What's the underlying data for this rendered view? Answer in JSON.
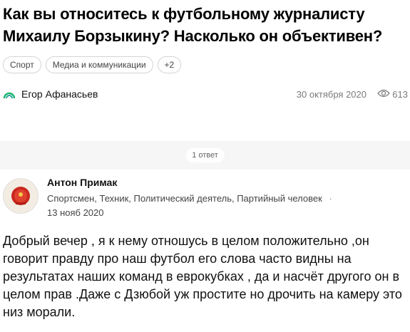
{
  "question": {
    "title": "Как вы относитесь к футбольному журналисту Михаилу Борзыкину? Насколько он объективен?",
    "tags": [
      "Спорт",
      "Медиа и коммуникации",
      "+2"
    ],
    "author": "Егор Афанасьев",
    "date": "30 октября 2020",
    "views": "613"
  },
  "answers_count": "1 ответ",
  "answer": {
    "author": "Антон Примак",
    "meta": "Спортсмен, Техник, Политический деятель, Партийный человек",
    "meta_sep": "·",
    "date": "13 нояб 2020",
    "text": "Добрый вечер , я к нему отношусь в целом положительно ,он говорит правду про наш футбол его слова часто видны на результатах наших команд в еврокубках , да и насчёт другого он в целом прав .Даже с Дзюбой уж простите но дрочить на камеру это низ морали."
  },
  "colors": {
    "logo_green": "#19b36b",
    "logo_teal": "#2aa6a0"
  }
}
